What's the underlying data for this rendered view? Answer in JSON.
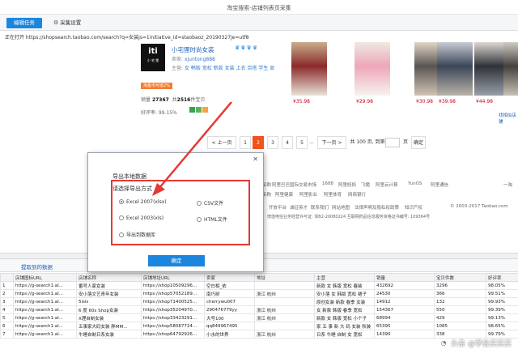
{
  "window": {
    "title": "淘宝搜索-店铺列表页采集"
  },
  "toolbar": {
    "task_label": "编辑任务",
    "settings_label": "采集设置"
  },
  "urlbar": {
    "text": "正在打开 https://shopsearch.taobao.com/search?q=女装js=1initiative_id=staobaoz_20190327je=utf8"
  },
  "shop": {
    "logo_mark": "iti",
    "logo_sub": "小 宅 狸",
    "name": "小宅狸时尚女装",
    "badges": "♛♛♛♛",
    "seller_label": "卖家:",
    "seller": "xjuntong888",
    "main_label": "主营:",
    "main_cats": "女 韩版 宽松 新款 女装 上衣 百搭 学生 显",
    "tag": "淘金币可抵2%",
    "sales_prefix": "销量",
    "sales": "27367",
    "items_prefix": "共",
    "items": "2516",
    "items_suffix": "件宝贝",
    "rate_label": "好评率: 99.15%"
  },
  "photos": [
    {
      "price": "¥35.98",
      "color_top": "#c9ad8d",
      "color_mid": "#8b2b2b",
      "color_bot": "#e9e1d6"
    },
    {
      "price": "¥29.98",
      "color_top": "#efe9e2",
      "color_mid": "#eea6b9",
      "color_bot": "#f7f3ef"
    },
    {
      "price": "¥30.98",
      "color_top": "#e2d6c6",
      "color_mid": "#5a5452",
      "color_bot": "#cfc4b4"
    },
    {
      "price": "¥39.98",
      "color_top": "#c8ccd3",
      "color_mid": "#3b4658",
      "color_bot": "#b9b2a8"
    },
    {
      "price": "¥44.98",
      "color_top": "#dcd9d4",
      "color_mid": "#2f3238",
      "color_bot": "#9aa0a8"
    },
    {
      "price": "",
      "color_top": "#d0cbc3",
      "color_mid": "#46413d",
      "color_bot": "#c8c0b5"
    }
  ],
  "more_link": "找相似店铺",
  "pager": {
    "prev": "< 上一页",
    "pages": [
      "1",
      "2",
      "3",
      "4",
      "5"
    ],
    "ellipsis": "...",
    "next": "下一页 >",
    "total_prefix": "共 100 页, 到第",
    "total_suffix": "页",
    "confirm": "确定"
  },
  "footer": {
    "row1": [
      "阿里巴巴国际交易市场",
      "1688",
      "阿里妈妈",
      "飞猪",
      "阿里云计算",
      "YunOS",
      "阿里通信",
      "一淘"
    ],
    "row2": [
      "阿里健康",
      "阿里影业",
      "阿里体育",
      "网商银行"
    ],
    "row3": [
      "开放平台",
      "诚征英才",
      "联系我们",
      "网站地图",
      "法律声明及隐私权政策",
      "知识产权"
    ],
    "copyright": "© 2003-2017 Taobao.com",
    "license": "增值电信业务经营许可证: 浙B2-20080224 互联网药品信息服务资格证书编号: 109364号",
    "left_left": "采购",
    "left_top": "采购"
  },
  "splitter": {
    "arrow": "⌄"
  },
  "data_tab": {
    "label": "提取到的数据"
  },
  "grid": {
    "columns": [
      "",
      "店铺图标URL",
      "店铺名称",
      "店铺地址URL",
      "卖家",
      "地址",
      "主营",
      "销量",
      "宝贝件数",
      "好评率"
    ],
    "rows": [
      [
        "1",
        "https://g-search1.al...",
        "番号人家女装",
        "https://shop10509296...",
        "空白相_依",
        "",
        "新款 女 韩版 宽松 春装",
        "432692",
        "3296",
        "98.05%"
      ],
      [
        "2",
        "https://g-search1.al...",
        "安小落文艺青年女装",
        "https://shop57052189...",
        "南巧树",
        "浙江 杭州",
        "安小落 女 韩版 宽松 裙子",
        "24530",
        "366",
        "99.51%"
      ],
      [
        "3",
        "https://g-search1.al...",
        "5isis",
        "https://shop71400525...",
        "cherrywu007",
        "",
        "原创女装 新款 春季 女装",
        "14912",
        "132",
        "99.93%"
      ],
      [
        "4",
        "https://g-search1.al...",
        "6 度 60s Shop女装",
        "https://shop35204970...",
        "290476779yy",
        "浙江 杭州",
        "女 新款 韩版 春季 宽松",
        "154367",
        "550",
        "99.39%"
      ],
      [
        "5",
        "https://g-search1.al...",
        "X理自制女装",
        "https://shop33423291...",
        "大号100",
        "浙江 杭州",
        "新款 女 韩版 宽松 小个子",
        "68994",
        "429",
        "99.13%"
      ],
      [
        "6",
        "https://g-search1.al...",
        "五事家大码女装 胖MM...",
        "https://shop58087724...",
        "qq849967495",
        "",
        "家 五 事 新 大 码 女装 秋装",
        "65395",
        "1085",
        "98.65%"
      ],
      [
        "7",
        "https://g-search1.al...",
        "牛睡自制日系女装",
        "https://shop64792926...",
        "小水的世界",
        "浙江 杭州",
        "日系 牛睡 自制 女 宽松",
        "14390",
        "338",
        "99.79%"
      ]
    ]
  },
  "dialog": {
    "close": "✕",
    "title": "导出本地数据",
    "subtitle": "请选择导出方式",
    "options": [
      "Excel 2007(xlsx)",
      "CSV文件",
      "Excel 2003(xls)",
      "HTML文件",
      "导出到数据库"
    ],
    "selected_index": 0,
    "ok_label": "确定",
    "annotation_color": "#e53935"
  },
  "watermark": {
    "text": "头条 @学会买买买",
    "icon": "◔"
  }
}
